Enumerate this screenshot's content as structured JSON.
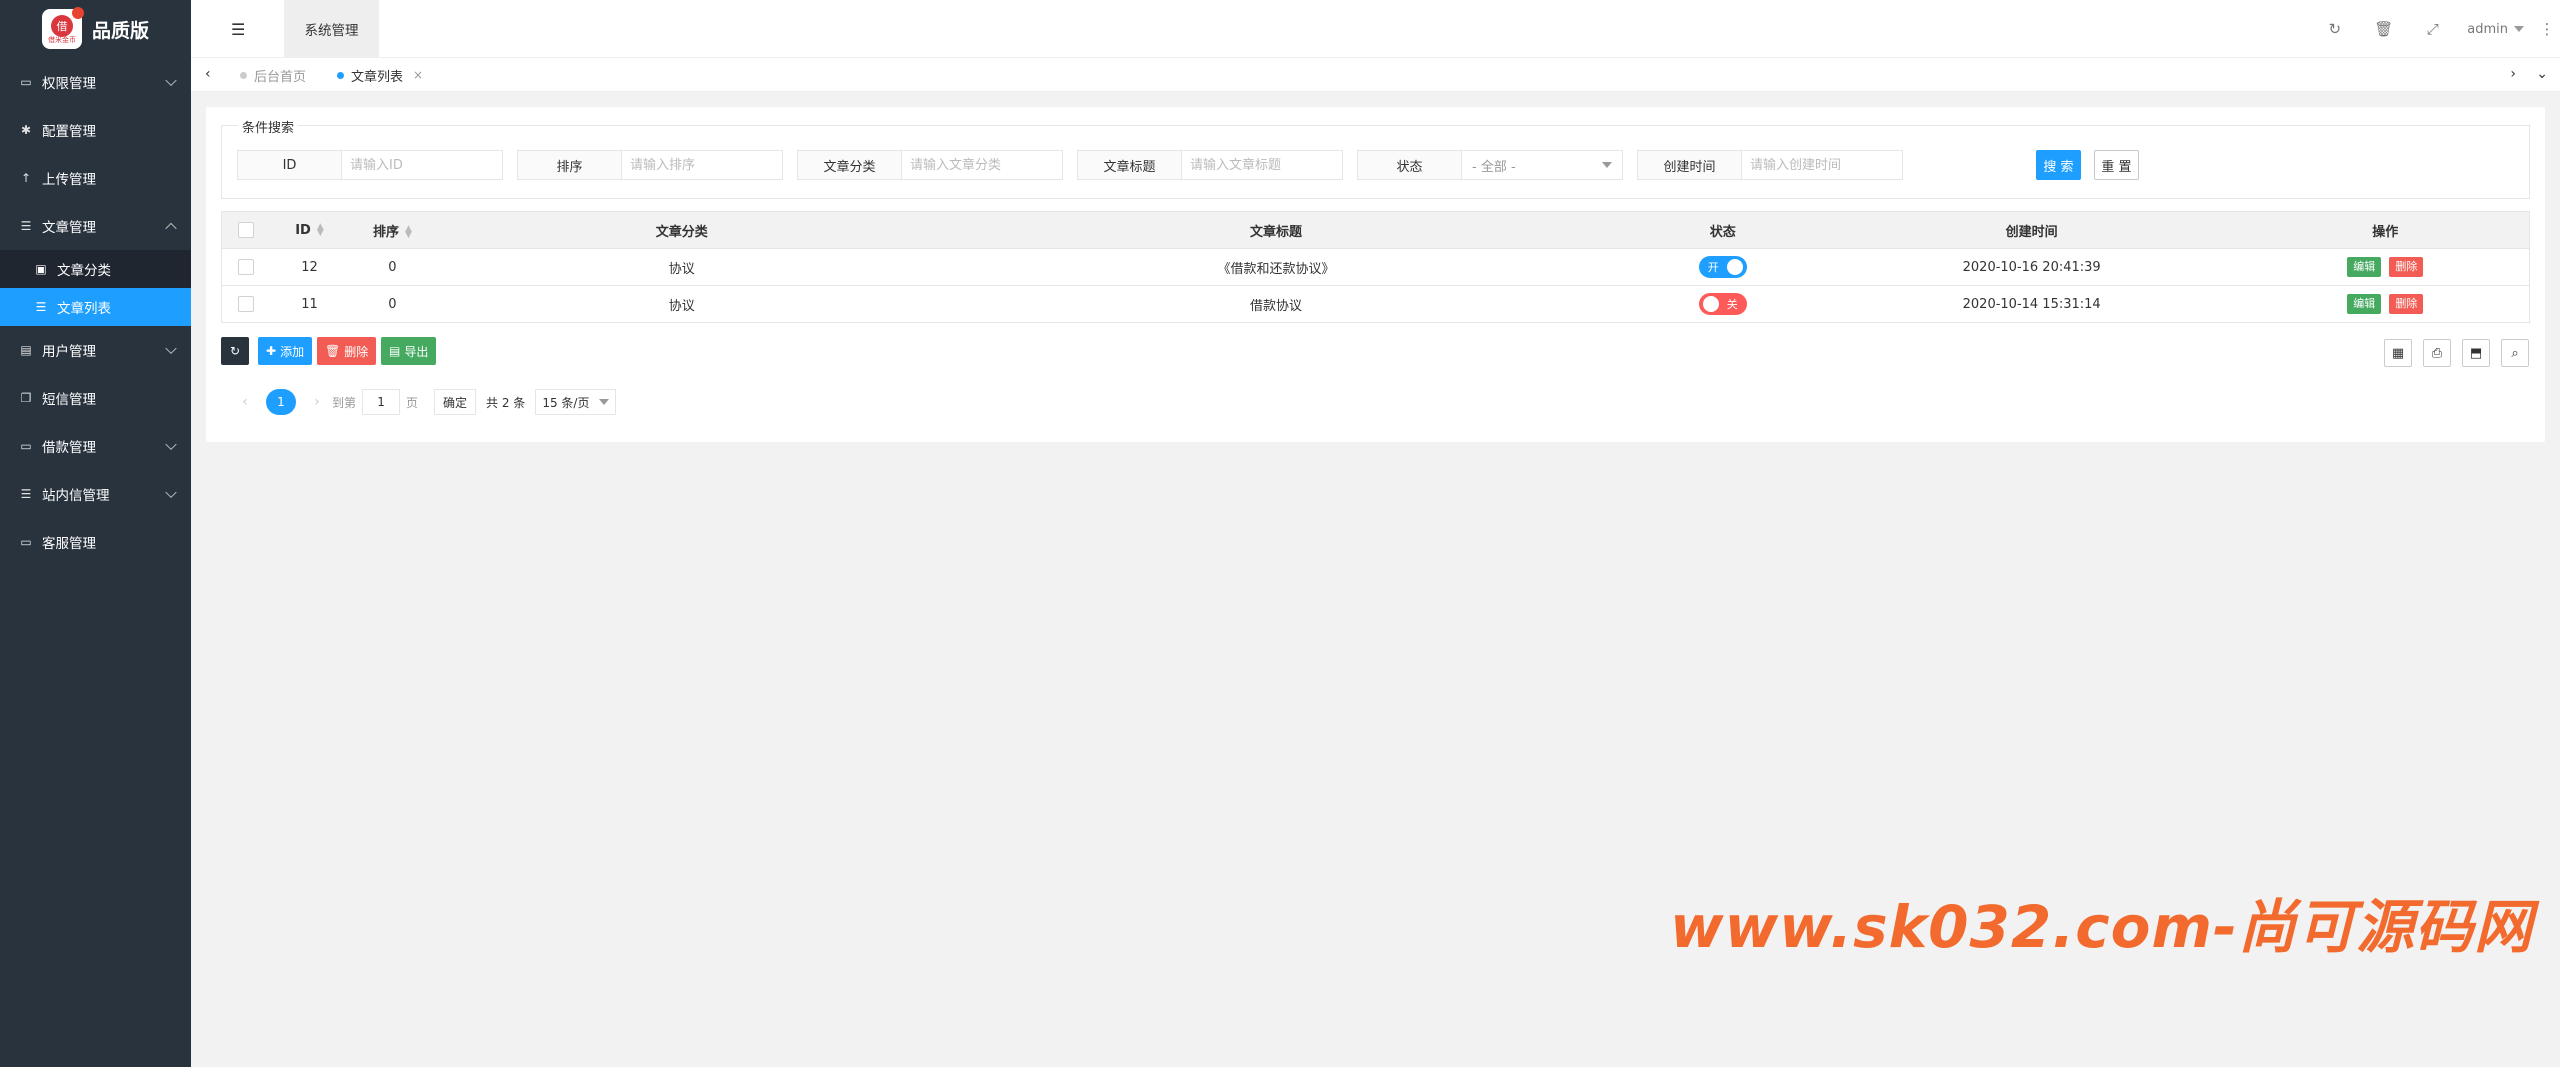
{
  "app": {
    "logo_text": "品质版",
    "logo_small": "借米金币"
  },
  "sidebar": {
    "items": [
      {
        "label": "权限管理",
        "icon": "laptop-icon"
      },
      {
        "label": "配置管理",
        "icon": "gear-icon"
      },
      {
        "label": "上传管理",
        "icon": "upload-icon"
      },
      {
        "label": "文章管理",
        "icon": "list-icon"
      },
      {
        "label": "用户管理",
        "icon": "user-icon"
      },
      {
        "label": "短信管理",
        "icon": "copy-icon"
      },
      {
        "label": "借款管理",
        "icon": "money-icon"
      },
      {
        "label": "站内信管理",
        "icon": "list-icon"
      },
      {
        "label": "客服管理",
        "icon": "monitor-icon"
      }
    ],
    "sub_items": [
      {
        "label": "文章分类"
      },
      {
        "label": "文章列表"
      }
    ]
  },
  "header": {
    "top_tab": "系统管理",
    "user": "admin"
  },
  "tabs": [
    {
      "label": "后台首页"
    },
    {
      "label": "文章列表"
    }
  ],
  "search": {
    "legend": "条件搜索",
    "fields": [
      {
        "label": "ID",
        "placeholder": "请输入ID"
      },
      {
        "label": "排序",
        "placeholder": "请输入排序"
      },
      {
        "label": "文章分类",
        "placeholder": "请输入文章分类"
      },
      {
        "label": "文章标题",
        "placeholder": "请输入文章标题"
      },
      {
        "label": "状态",
        "placeholder": "- 全部 -"
      },
      {
        "label": "创建时间",
        "placeholder": "请输入创建时间"
      }
    ],
    "search_label": "搜 索",
    "reset_label": "重 置"
  },
  "table": {
    "headers": [
      "ID",
      "排序",
      "文章分类",
      "文章标题",
      "状态",
      "创建时间",
      "操作"
    ],
    "rows": [
      {
        "id": "12",
        "sort": "0",
        "category": "协议",
        "title": "《借款和还款协议》",
        "status": "开",
        "status_on": true,
        "created": "2020-10-16 20:41:39"
      },
      {
        "id": "11",
        "sort": "0",
        "category": "协议",
        "title": "借款协议",
        "status": "关",
        "status_on": false,
        "created": "2020-10-14 15:31:14"
      }
    ],
    "edit_label": "编辑",
    "delete_label": "删除"
  },
  "toolbar": {
    "add_label": "添加",
    "delete_label": "删除",
    "export_label": "导出"
  },
  "pager": {
    "current": "1",
    "goto_label": "到第",
    "page_input": "1",
    "page_unit": "页",
    "confirm_label": "确定",
    "total": "共 2 条",
    "page_size": "15 条/页"
  },
  "watermark": "www.sk032.com-尚可源码网",
  "colors": {
    "primary": "#1e9fff",
    "sidebar": "#28333e",
    "danger": "#f25c54",
    "success": "#45a960"
  }
}
